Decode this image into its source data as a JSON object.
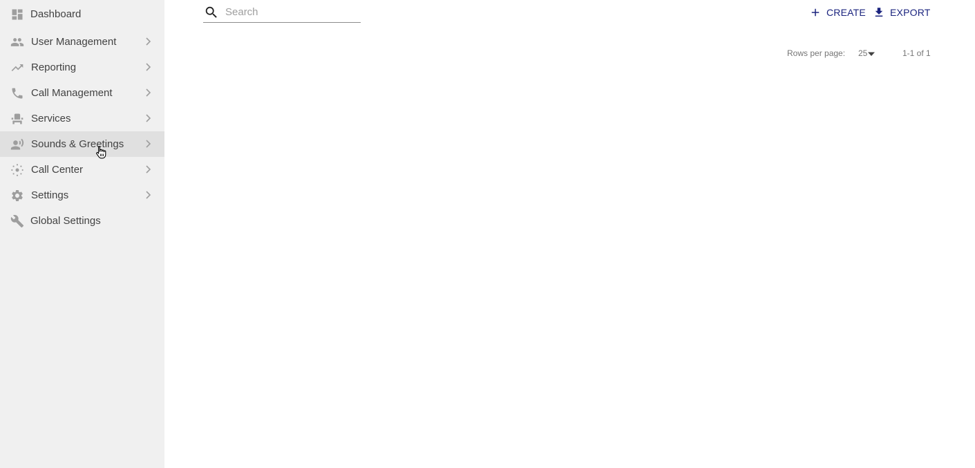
{
  "sidebar": {
    "items": [
      {
        "label": "Dashboard",
        "icon": "dashboard-icon",
        "has_submenu": false
      },
      {
        "label": "User Management",
        "icon": "people-icon",
        "has_submenu": true
      },
      {
        "label": "Reporting",
        "icon": "trending-icon",
        "has_submenu": true
      },
      {
        "label": "Call Management",
        "icon": "phone-icon",
        "has_submenu": true
      },
      {
        "label": "Services",
        "icon": "services-icon",
        "has_submenu": true
      },
      {
        "label": "Sounds & Greetings",
        "icon": "voice-icon",
        "has_submenu": true,
        "active": true
      },
      {
        "label": "Call Center",
        "icon": "call-center-icon",
        "has_submenu": true
      },
      {
        "label": "Settings",
        "icon": "gear-icon",
        "has_submenu": true
      },
      {
        "label": "Global Settings",
        "icon": "wrench-icon",
        "has_submenu": false
      }
    ]
  },
  "search": {
    "placeholder": "Search",
    "value": ""
  },
  "toolbar": {
    "create_label": "CREATE",
    "export_label": "EXPORT"
  },
  "pagination": {
    "rows_per_page_label": "Rows per page:",
    "rows_per_page": "25",
    "range": "1-1 of 1"
  },
  "colors": {
    "sidebar_bg": "#f0f0f0",
    "active_bg": "#e0e0e0",
    "accent": "#1a237e"
  }
}
